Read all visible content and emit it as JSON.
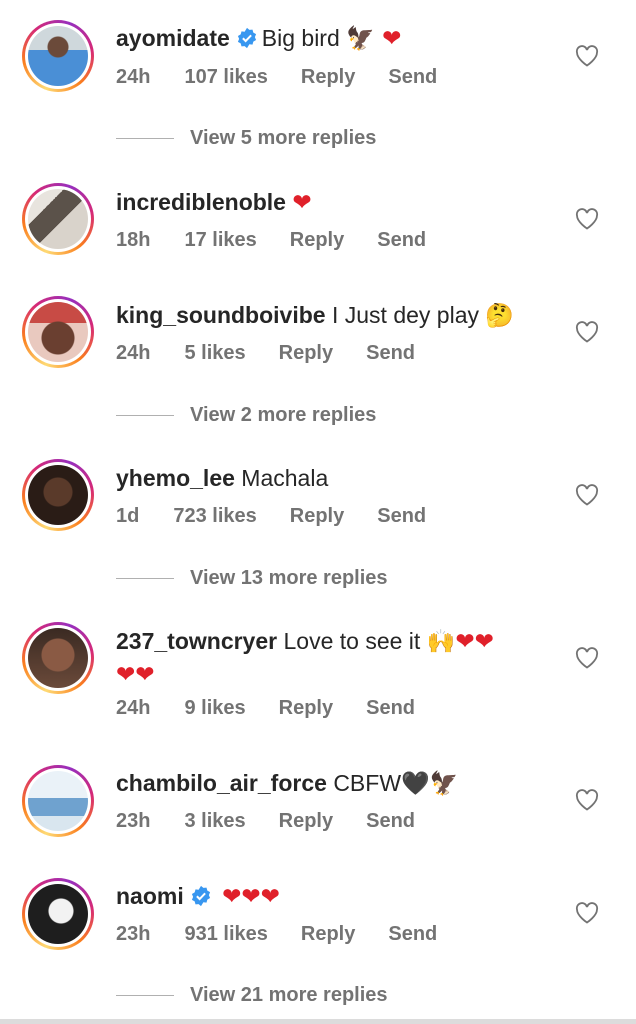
{
  "comments": [
    {
      "username": "ayomidate",
      "verified": true,
      "text": "Big bird",
      "emoji": "🦅 ❤",
      "time": "24h",
      "likes": "107 likes",
      "reply": "Reply",
      "send": "Send",
      "more": "View 5 more replies",
      "avatar_color": "#4a8fd6"
    },
    {
      "username": "incrediblenoble",
      "verified": false,
      "text": "",
      "emoji": "❤",
      "time": "18h",
      "likes": "17 likes",
      "reply": "Reply",
      "send": "Send",
      "more": "",
      "avatar_color": "#7a6e63"
    },
    {
      "username": "king_soundboivibe",
      "verified": false,
      "text": "I Just dey play",
      "emoji": "🤔",
      "time": "24h",
      "likes": "5 likes",
      "reply": "Reply",
      "send": "Send",
      "more": "View 2 more replies",
      "avatar_color": "#b34a45"
    },
    {
      "username": "yhemo_lee",
      "verified": false,
      "text": "Machala",
      "emoji": "",
      "time": "1d",
      "likes": "723 likes",
      "reply": "Reply",
      "send": "Send",
      "more": "View 13 more replies",
      "avatar_color": "#3a2a22"
    },
    {
      "username": "237_towncryer",
      "verified": false,
      "text": "Love to see it",
      "emoji": "🙌❤❤",
      "emoji2": "❤❤",
      "time": "24h",
      "likes": "9 likes",
      "reply": "Reply",
      "send": "Send",
      "more": "",
      "avatar_color": "#8a5a44"
    },
    {
      "username": "chambilo_air_force",
      "verified": false,
      "text": "CBFW",
      "emoji": "🖤🦅",
      "time": "23h",
      "likes": "3 likes",
      "reply": "Reply",
      "send": "Send",
      "more": "",
      "avatar_color": "#6fa2cf"
    },
    {
      "username": "naomi",
      "verified": true,
      "text": "",
      "emoji": "❤❤❤",
      "time": "23h",
      "likes": "931 likes",
      "reply": "Reply",
      "send": "Send",
      "more": "View 21 more replies",
      "avatar_color": "#1e1e1e"
    }
  ],
  "colors": {
    "verified": "#3897f0",
    "heart": "#e0202a",
    "meta": "#737373"
  }
}
